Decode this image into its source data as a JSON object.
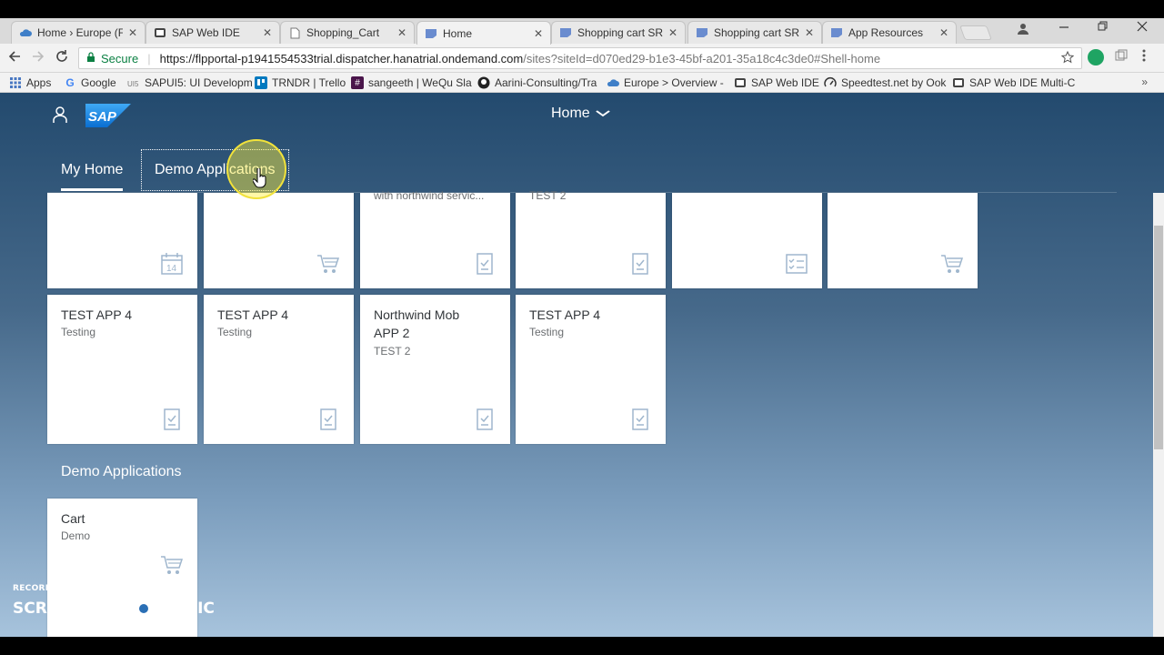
{
  "browser": {
    "tabs": [
      {
        "label": "Home › Europe (F",
        "icon": "cloud-icon",
        "active": false
      },
      {
        "label": "SAP Web IDE",
        "icon": "sap-ide-icon",
        "active": false
      },
      {
        "label": "Shopping_Cart",
        "icon": "page-icon",
        "active": false
      },
      {
        "label": "Home",
        "icon": "sap-favicon",
        "active": true
      },
      {
        "label": "Shopping cart SRI",
        "icon": "sap-favicon",
        "active": false
      },
      {
        "label": "Shopping cart SRI",
        "icon": "sap-favicon",
        "active": false
      },
      {
        "label": "App Resources",
        "icon": "sap-favicon",
        "active": false
      }
    ],
    "tab_close": "✕",
    "address": {
      "secure_label": "Secure",
      "url_main": "https://flpportal-p1941554533trial.dispatcher.hanatrial.ondemand.com",
      "url_rest": "/sites?siteId=d070ed29-b1e3-45bf-a201-35a18c4c3de0#Shell-home"
    },
    "bookmarks": [
      {
        "label": "Apps",
        "icon": "apps-grid-icon"
      },
      {
        "label": "Google",
        "icon": "google-icon"
      },
      {
        "label": "SAPUI5: UI Developm",
        "icon": "sapui5-icon"
      },
      {
        "label": "TRNDR | Trello",
        "icon": "trello-icon"
      },
      {
        "label": "sangeeth | WeQu Sla",
        "icon": "slack-icon"
      },
      {
        "label": "Aarini-Consulting/Tra",
        "icon": "github-icon"
      },
      {
        "label": "Europe > Overview -",
        "icon": "cloud-icon"
      },
      {
        "label": "SAP Web IDE",
        "icon": "sap-ide-icon"
      },
      {
        "label": "Speedtest.net by Ook",
        "icon": "speedometer-icon"
      },
      {
        "label": "SAP Web IDE Multi-C",
        "icon": "sap-ide-icon"
      }
    ],
    "bookmarks_more": "»"
  },
  "shell": {
    "title": "Home",
    "anchors": [
      {
        "label": "My Home",
        "selected": true
      },
      {
        "label": "Demo Applications",
        "selected": false
      }
    ]
  },
  "tiles_row1": [
    {
      "partial": "",
      "icon": "calendar-icon",
      "icon_text": "14"
    },
    {
      "partial": "",
      "icon": "cart-icon"
    },
    {
      "partial": "with northwind servic...",
      "icon": "document-icon"
    },
    {
      "partial": "TEST 2",
      "icon": "document-icon"
    },
    {
      "partial": "",
      "icon": "checklist-icon"
    },
    {
      "partial": "",
      "icon": "cart-icon"
    }
  ],
  "tiles_row2": [
    {
      "title": "TEST APP 4",
      "subtitle": "Testing",
      "icon": "document-icon"
    },
    {
      "title": "TEST APP 4",
      "subtitle": "Testing",
      "icon": "document-icon"
    },
    {
      "title": "Northwind Mob APP 2",
      "subtitle": "TEST 2",
      "icon": "document-icon"
    },
    {
      "title": "TEST APP 4",
      "subtitle": "Testing",
      "icon": "document-icon"
    }
  ],
  "group": {
    "title": "Demo Applications",
    "tiles": [
      {
        "title": "Cart",
        "subtitle": "Demo",
        "icon": "cart-icon"
      }
    ]
  },
  "watermark": {
    "top": "RECORDED WITH",
    "left": "SCREENCAST",
    "right": "MATIC"
  }
}
